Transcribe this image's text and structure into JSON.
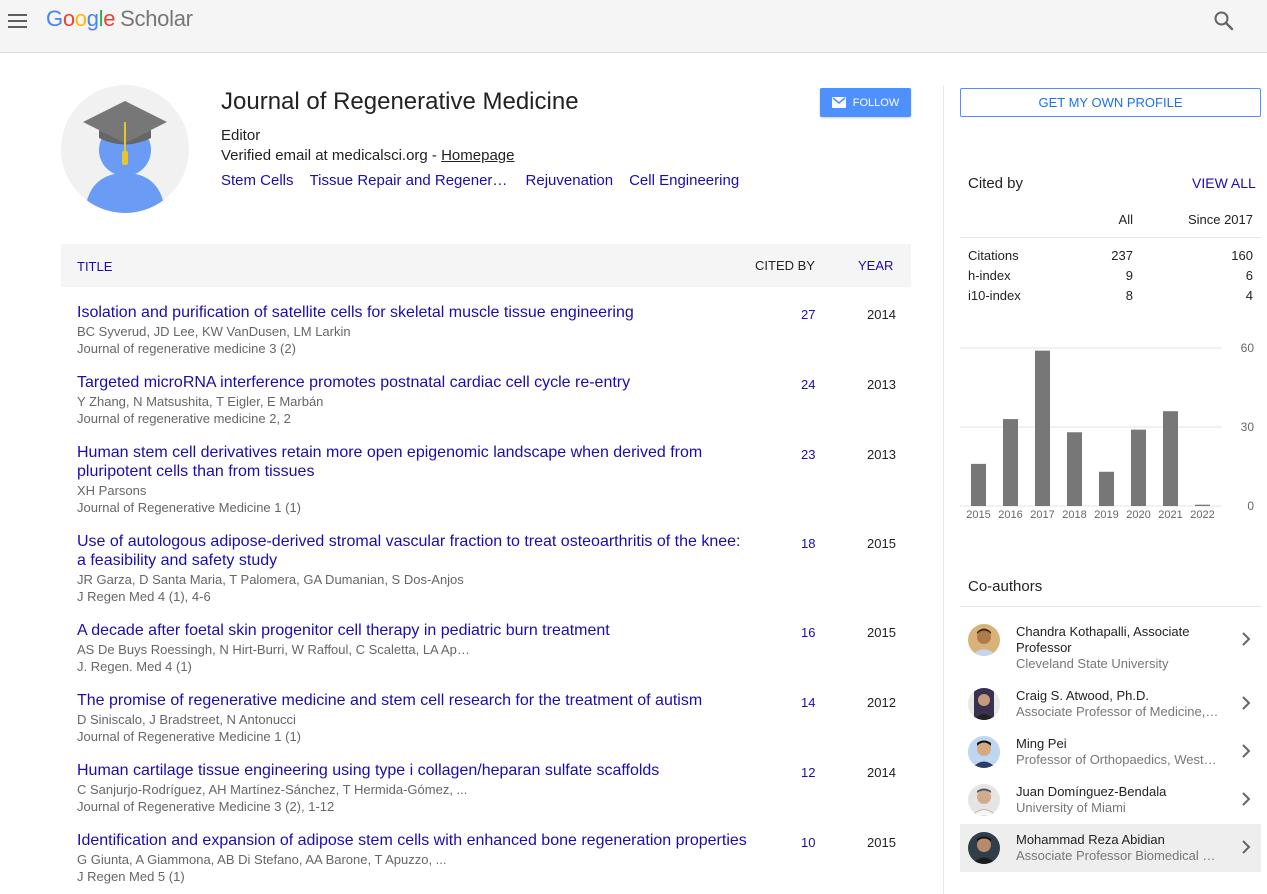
{
  "header": {
    "logo_letters": [
      "G",
      "o",
      "o",
      "g",
      "l",
      "e"
    ],
    "logo_product": "Scholar"
  },
  "profile": {
    "name": "Journal of Regenerative Medicine",
    "affiliation": "Editor",
    "email_text": "Verified email at medicalsci.org - ",
    "homepage_label": "Homepage",
    "interests": [
      "Stem Cells",
      "Tissue Repair and Regeneration",
      "Rejuvenation",
      "Cell Engineering"
    ],
    "follow_label": "FOLLOW"
  },
  "table": {
    "col_title": "TITLE",
    "col_cited": "CITED BY",
    "col_year": "YEAR",
    "rows": [
      {
        "title": "Isolation and purification of satellite cells for skeletal muscle tissue engineering",
        "authors": "BC Syverud, JD Lee, KW VanDusen, LM Larkin",
        "venue": "Journal of regenerative medicine 3 (2)",
        "cited": "27",
        "year": "2014"
      },
      {
        "title": "Targeted microRNA interference promotes postnatal cardiac cell cycle re-entry",
        "authors": "Y Zhang, N Matsushita, T Eigler, E Marbán",
        "venue": "Journal of regenerative medicine 2, 2",
        "cited": "24",
        "year": "2013"
      },
      {
        "title": "Human stem cell derivatives retain more open epigenomic landscape when derived from pluripotent cells than from tissues",
        "authors": "XH Parsons",
        "venue": "Journal of Regenerative Medicine 1 (1)",
        "cited": "23",
        "year": "2013"
      },
      {
        "title": "Use of autologous adipose-derived stromal vascular fraction to treat osteoarthritis of the knee: a feasibility and safety study",
        "authors": "JR Garza, D Santa Maria, T Palomera, GA Dumanian, S Dos-Anjos",
        "venue": "J Regen Med 4 (1), 4-6",
        "cited": "18",
        "year": "2015"
      },
      {
        "title": "A decade after foetal skin progenitor cell therapy in pediatric burn treatment",
        "authors": "AS De Buys Roessingh, N Hirt-Burri, W Raffoul, C Scaletta, LA Applegate",
        "venue": "J. Regen. Med 4 (1)",
        "cited": "16",
        "year": "2015"
      },
      {
        "title": "The promise of regenerative medicine and stem cell research for the treatment of autism",
        "authors": "D Siniscalo, J Bradstreet, N Antonucci",
        "venue": "Journal of Regenerative Medicine 1 (1)",
        "cited": "14",
        "year": "2012"
      },
      {
        "title": "Human cartilage tissue engineering using type i collagen/heparan sulfate scaffolds",
        "authors": "C Sanjurjo-Rodríguez, AH Martínez-Sánchez, T Hermida-Gómez, ...",
        "venue": "Journal of Regenerative Medicine 3 (2), 1-12",
        "cited": "12",
        "year": "2014"
      },
      {
        "title": "Identification and expansion of adipose stem cells with enhanced bone regeneration properties",
        "authors": "G Giunta, A Giammona, AB Di Stefano, AA Barone, T Apuzzo, ...",
        "venue": "J Regen Med 5 (1)",
        "cited": "10",
        "year": "2015"
      }
    ]
  },
  "sidebar": {
    "own_profile_label": "GET MY OWN PROFILE",
    "cited_by_label": "Cited by",
    "view_all_label": "VIEW ALL",
    "col_all": "All",
    "col_since": "Since 2017",
    "metrics": [
      {
        "label": "Citations",
        "all": "237",
        "since": "160"
      },
      {
        "label": "h-index",
        "all": "9",
        "since": "6"
      },
      {
        "label": "i10-index",
        "all": "8",
        "since": "4"
      }
    ],
    "coauthors_label": "Co-authors",
    "coauthors": [
      {
        "name": "Chandra Kothapalli, Associate Professor",
        "affiliation": "Cleveland State University"
      },
      {
        "name": "Craig S. Atwood, Ph.D.",
        "affiliation": "Associate Professor of Medicine, University of Wisconsin"
      },
      {
        "name": "Ming Pei",
        "affiliation": "Professor of Orthopaedics, West Virginia University"
      },
      {
        "name": "Juan Domínguez-Bendala",
        "affiliation": "University of Miami"
      },
      {
        "name": "Mohammad Reza Abidian",
        "affiliation": "Associate Professor Biomedical Engineering"
      }
    ]
  },
  "chart_data": {
    "type": "bar",
    "categories": [
      "2015",
      "2016",
      "2017",
      "2018",
      "2019",
      "2020",
      "2021",
      "2022"
    ],
    "values": [
      16,
      33,
      59,
      28,
      13,
      29,
      36,
      0.5
    ],
    "ylim": [
      0,
      60
    ],
    "yticks": [
      0,
      30,
      60
    ],
    "grid": true,
    "bar_color": "#777777"
  }
}
